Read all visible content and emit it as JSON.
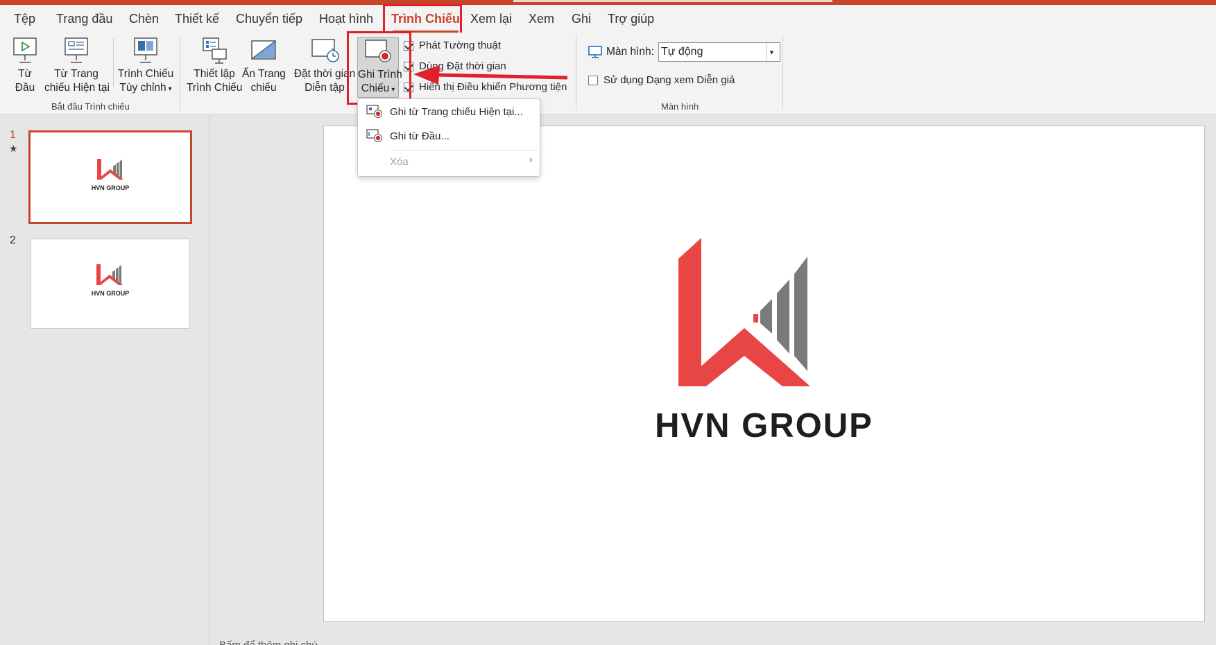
{
  "tabs": [
    {
      "label": "Tệp"
    },
    {
      "label": "Trang đầu"
    },
    {
      "label": "Chèn"
    },
    {
      "label": "Thiết kế"
    },
    {
      "label": "Chuyển tiếp"
    },
    {
      "label": "Hoạt hình"
    },
    {
      "label": "Trình Chiếu",
      "active": true
    },
    {
      "label": "Xem lại"
    },
    {
      "label": "Xem"
    },
    {
      "label": "Ghi"
    },
    {
      "label": "Trợ giúp"
    }
  ],
  "ribbon": {
    "start_group": {
      "label": "Bắt đầu Trình chiếu",
      "from_beginning": [
        "Từ",
        "Đầu"
      ],
      "from_current": [
        "Từ Trang",
        "chiếu Hiện tại"
      ],
      "custom_show": [
        "Trình Chiếu",
        "Tùy chỉnh"
      ]
    },
    "setup_group": {
      "setup": [
        "Thiết lập",
        "Trình Chiếu"
      ],
      "hide_slide": [
        "Ẩn Trang",
        "chiếu"
      ],
      "rehearse": [
        "Đặt thời gian",
        "Diễn tập"
      ],
      "record": [
        "Ghi Trình",
        "Chiếu"
      ],
      "checkboxes": [
        {
          "label": "Phát Tường thuật",
          "checked": true
        },
        {
          "label": "Dùng Đặt thời gian",
          "checked": true
        },
        {
          "label": "Hiển thị Điều khiển Phương tiện",
          "checked": true
        }
      ]
    },
    "monitor_group": {
      "label": "Màn hình",
      "monitor_label": "Màn hình:",
      "monitor_value": "Tự động",
      "presenter_view": {
        "label": "Sử dụng Dạng xem Diễn giả",
        "checked": false
      }
    }
  },
  "record_menu": {
    "items": [
      {
        "label": "Ghi từ Trang chiếu Hiện tại...",
        "enabled": true
      },
      {
        "label": "Ghi từ Đầu...",
        "enabled": true
      },
      {
        "label": "Xóa",
        "enabled": false
      }
    ]
  },
  "slides": [
    {
      "number": "1",
      "selected": true,
      "logo_text": "HVN GROUP"
    },
    {
      "number": "2",
      "selected": false,
      "logo_text": "HVN GROUP"
    }
  ],
  "main_slide": {
    "logo_text": "HVN GROUP"
  },
  "notes_hint": "Bấm để thêm ghi chú",
  "colors": {
    "accent": "#c8452a",
    "annotation": "#e0202a",
    "logo_red": "#e84545",
    "logo_gray": "#7a7a7a"
  }
}
